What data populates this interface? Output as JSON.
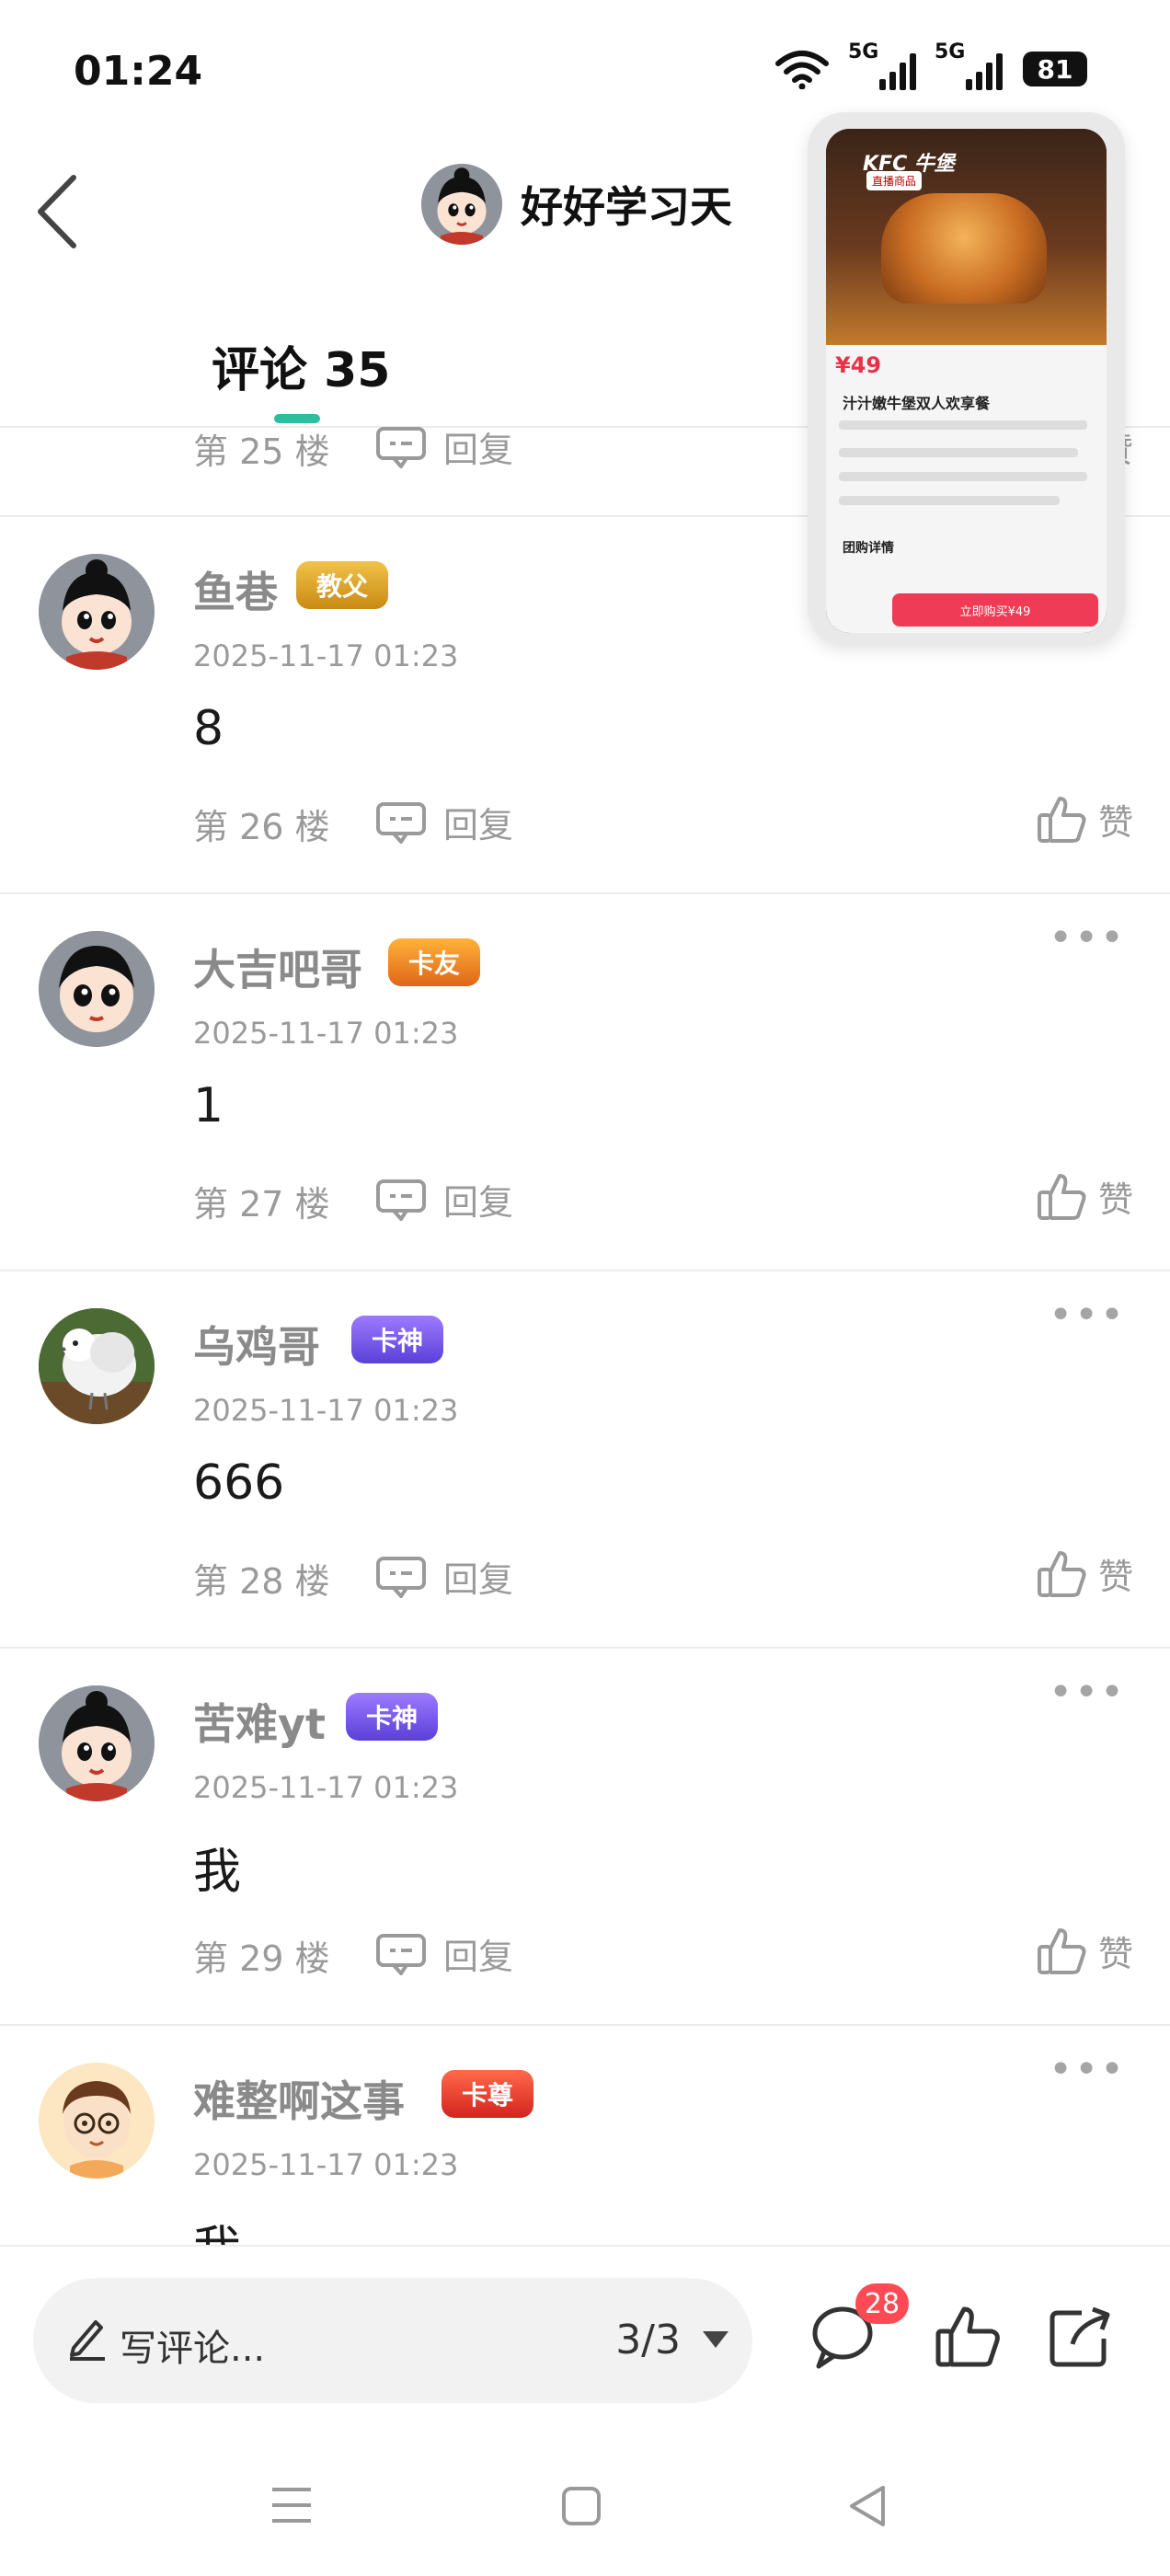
{
  "status_bar": {
    "time": "01:24",
    "signal_1": "5G",
    "signal_2": "5G",
    "battery": "81",
    "icons": [
      "wifi-icon",
      "signal-icon",
      "signal-icon",
      "battery-icon"
    ]
  },
  "header": {
    "author_name": "好好学习天",
    "comments_tab": "评论 35",
    "back_icon": "chevron-left-icon"
  },
  "partial_comment": {
    "floor": "第 25 楼",
    "reply_label": "回复",
    "like_label": "赞"
  },
  "comments": [
    {
      "name": "鱼巷",
      "badge": "教父",
      "time": "2025-11-17 01:23",
      "text": "8",
      "floor": "第 26 楼",
      "reply_label": "回复",
      "like_label": "赞"
    },
    {
      "name": "大吉吧哥",
      "badge": "卡友",
      "time": "2025-11-17 01:23",
      "text": "1",
      "floor": "第 27 楼",
      "reply_label": "回复",
      "like_label": "赞"
    },
    {
      "name": "乌鸡哥",
      "badge": "卡神",
      "time": "2025-11-17 01:23",
      "text": "666",
      "floor": "第 28 楼",
      "reply_label": "回复",
      "like_label": "赞"
    },
    {
      "name": "苦难yt",
      "badge": "卡神",
      "time": "2025-11-17 01:23",
      "text": "我",
      "floor": "第 29 楼",
      "reply_label": "回复",
      "like_label": "赞"
    },
    {
      "name": "难整啊这事",
      "badge": "卡尊",
      "time": "2025-11-17 01:23",
      "text": "我"
    }
  ],
  "float_window": {
    "logo": "KFC 牛堡",
    "sub_label": "直播商品",
    "price": "¥49",
    "title": "汁汁嫩牛堡双人欢享餐",
    "detail_label": "团购详情",
    "buy_label": "立即购买¥49"
  },
  "bottom_bar": {
    "input_placeholder": "写评论...",
    "page_indicator": "3/3",
    "comment_count": "28",
    "icons": [
      "pencil-icon",
      "comment-icon",
      "thumbs-up-icon",
      "share-icon"
    ]
  },
  "colors": {
    "accent_tab": "#2bbf9f",
    "notification": "#ff4a55",
    "badge_jiaofu": "#d9a321",
    "badge_kayou": "#f08a1c",
    "badge_kashen": "#7a5cf0",
    "badge_kazun": "#e8442c"
  }
}
